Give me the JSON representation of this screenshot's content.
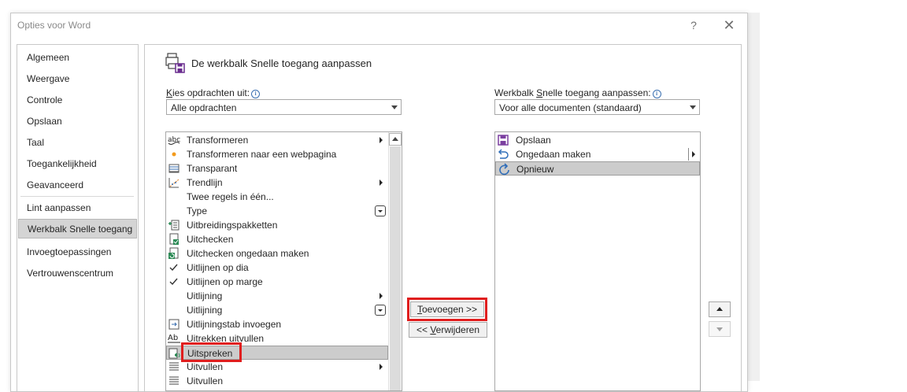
{
  "window": {
    "title": "Opties voor Word",
    "help": "?",
    "close": "✕"
  },
  "sidebar": {
    "items": [
      {
        "label": "Algemeen"
      },
      {
        "label": "Weergave"
      },
      {
        "label": "Controle"
      },
      {
        "label": "Opslaan"
      },
      {
        "label": "Taal"
      },
      {
        "label": "Toegankelijkheid"
      },
      {
        "label": "Geavanceerd"
      },
      {
        "label": "Lint aanpassen"
      },
      {
        "label": "Werkbalk Snelle toegang",
        "selected": true
      },
      {
        "label": "Invoegtoepassingen"
      },
      {
        "label": "Vertrouwenscentrum"
      }
    ]
  },
  "main": {
    "heading": "De werkbalk Snelle toegang aanpassen",
    "choose_label_k": "K",
    "choose_label_rest": "ies opdrachten uit:",
    "choose_value": "Alle opdrachten",
    "customize_label_pre": "Werkbalk ",
    "customize_label_s": "S",
    "customize_label_rest": "nelle toegang aanpassen:",
    "customize_value": "Voor alle documenten (standaard)",
    "info_icon": "i",
    "commands": [
      {
        "label": "Transformeren",
        "icon": "abc-icon",
        "submenu": true
      },
      {
        "label": "Transformeren naar een webpagina",
        "icon": "orange-dot-icon"
      },
      {
        "label": "Transparant",
        "icon": "transparency-icon"
      },
      {
        "label": "Trendlijn",
        "icon": "trendline-icon",
        "submenu": true
      },
      {
        "label": "Twee regels in één..."
      },
      {
        "label": "Type",
        "dropdown": true
      },
      {
        "label": "Uitbreidingspakketten",
        "icon": "expansion-pack-icon"
      },
      {
        "label": "Uitchecken",
        "icon": "checkout-icon"
      },
      {
        "label": "Uitchecken ongedaan maken",
        "icon": "discard-checkout-icon"
      },
      {
        "label": "Uitlijnen op dia",
        "icon": "checkmark-icon"
      },
      {
        "label": "Uitlijnen op marge",
        "icon": "checkmark-icon"
      },
      {
        "label": "Uitlijning",
        "submenu": true
      },
      {
        "label": "Uitlijning",
        "dropdown": true
      },
      {
        "label": "Uitlijningstab invoegen",
        "icon": "insert-tab-icon"
      },
      {
        "label": "Uitrekken uitvullen",
        "icon": "stretch-justify-icon"
      },
      {
        "label": "Uitspreken",
        "icon": "speak-icon",
        "selected": true
      },
      {
        "label": "Uitvullen",
        "icon": "justify-icon",
        "submenu": true
      },
      {
        "label": "Uitvullen",
        "icon": "justify-icon"
      }
    ],
    "toolbar_items": [
      {
        "label": "Opslaan",
        "icon": "save-icon"
      },
      {
        "label": "Ongedaan maken",
        "icon": "undo-icon",
        "submenu": true
      },
      {
        "label": "Opnieuw",
        "icon": "redo-icon",
        "selected": true
      }
    ],
    "add_button_t": "T",
    "add_button_rest": "oevoegen >>",
    "remove_button_pre": "<< ",
    "remove_button_v": "V",
    "remove_button_rest": "erwijderen"
  },
  "colors": {
    "highlight": "#e01e1e",
    "selection": "#cccccc",
    "save_icon": "#7b3fa0",
    "redo_icon": "#2f6db8"
  }
}
